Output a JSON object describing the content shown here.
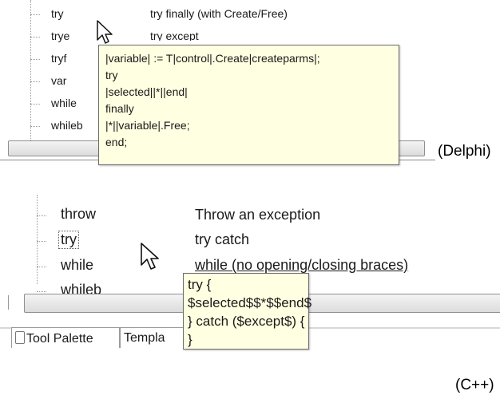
{
  "delphi": {
    "items": [
      {
        "name": "try",
        "desc": "try finally (with Create/Free)"
      },
      {
        "name": "trye",
        "desc": "try except"
      },
      {
        "name": "tryf",
        "desc": ""
      },
      {
        "name": "var",
        "desc": ""
      },
      {
        "name": "while",
        "desc": ""
      },
      {
        "name": "whileb",
        "desc": ""
      }
    ],
    "tooltip_lines": [
      "|variable| := T|control|.Create|createparms|;",
      "try",
      "|selected||*||end|",
      "finally",
      "|*||variable|.Free;",
      "end;"
    ],
    "caption": "(Delphi)"
  },
  "cpp": {
    "items": [
      {
        "name": "throw",
        "desc": "Throw an exception"
      },
      {
        "name": "try",
        "desc": "try catch"
      },
      {
        "name": "while",
        "desc": "while (no opening/closing braces)"
      },
      {
        "name": "whileb",
        "desc": ""
      }
    ],
    "tooltip_lines": [
      "try {",
      "$selected$$*$$end$",
      "} catch ($except$) {",
      "}"
    ],
    "tabs": [
      "Tool Palette",
      "Templa"
    ],
    "caption": "(C++)"
  }
}
